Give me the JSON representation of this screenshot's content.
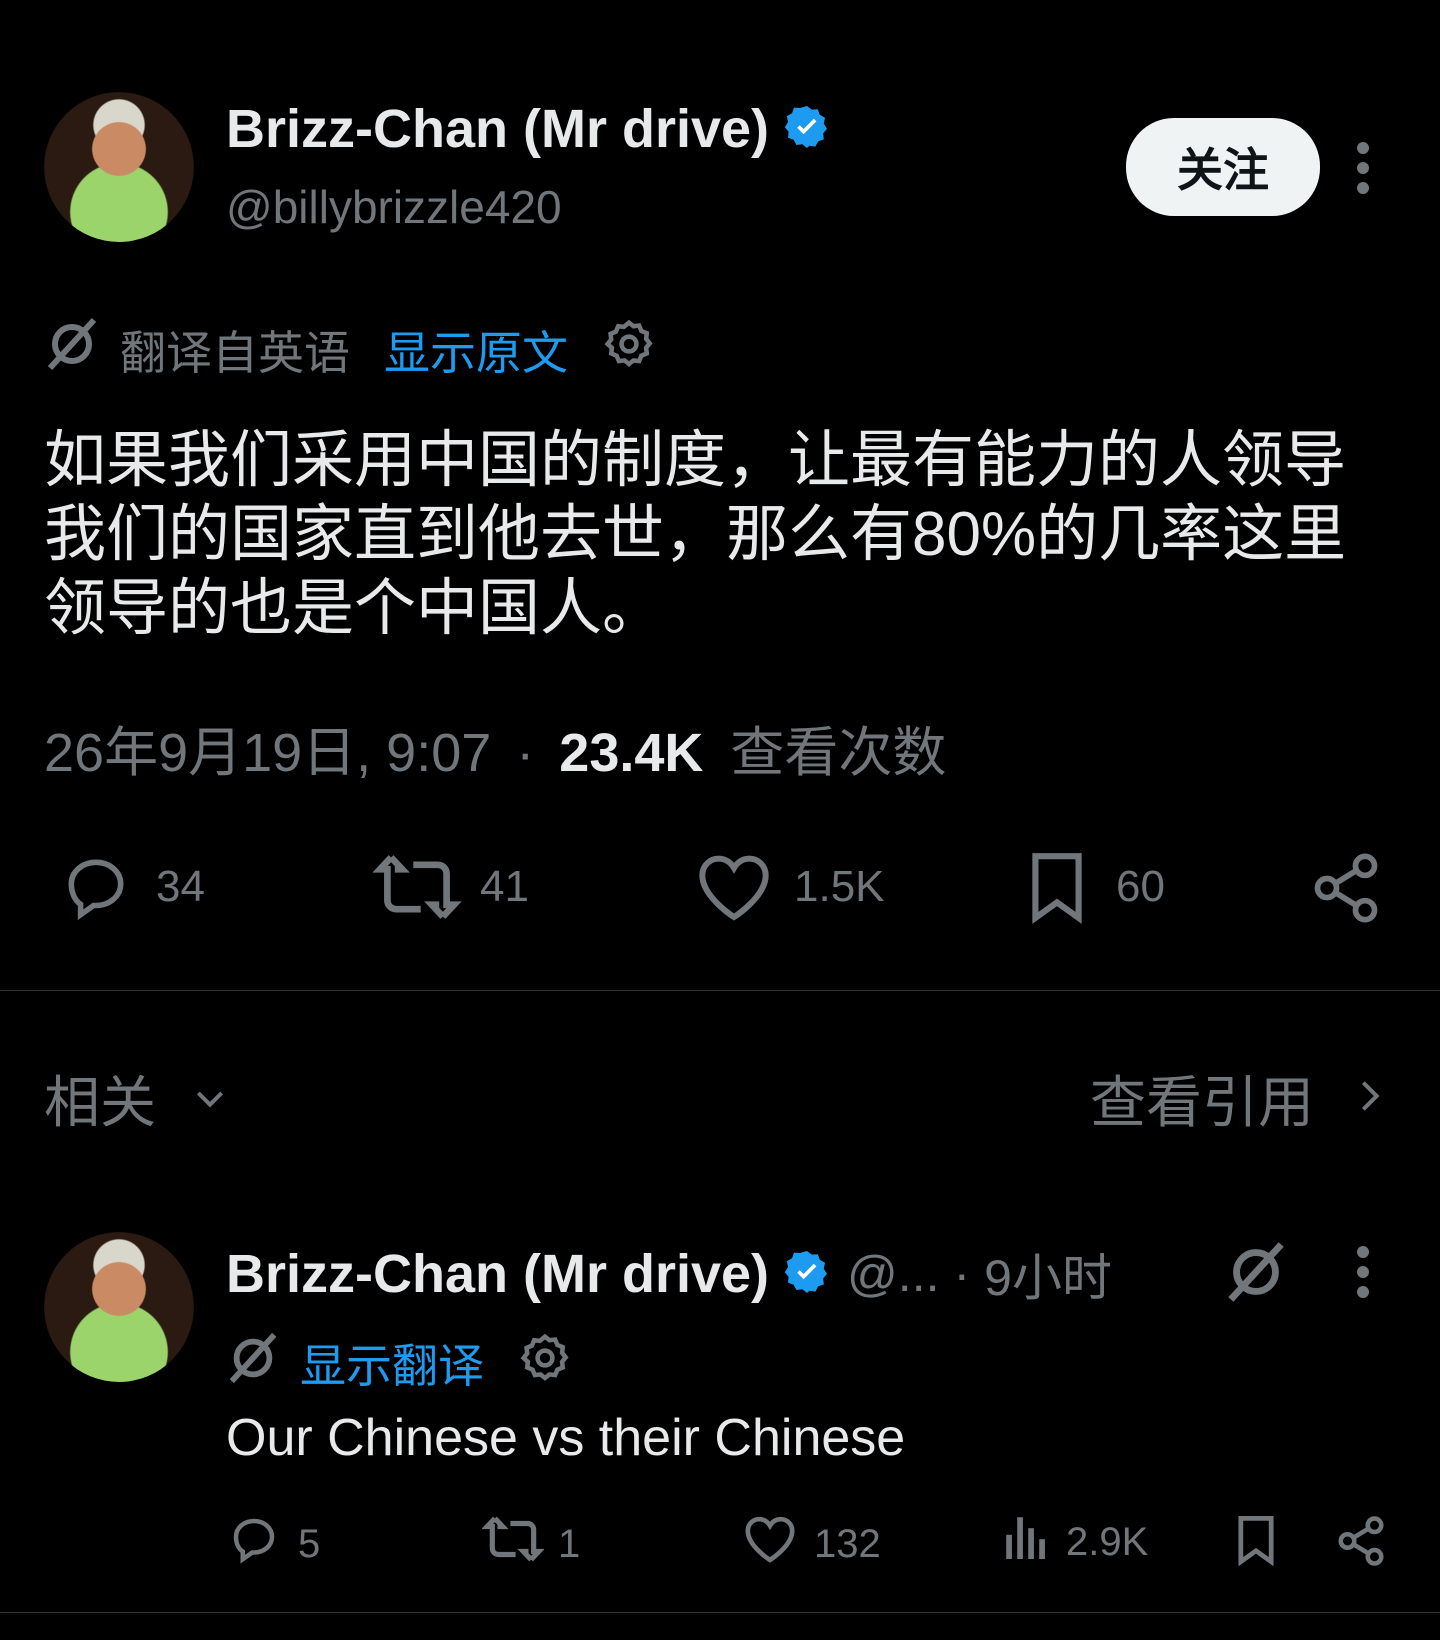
{
  "main_tweet": {
    "author_name": "Brizz-Chan (Mr drive)",
    "handle": "@billybrizzle420",
    "follow_label": "关注",
    "translated_from": "翻译自英语",
    "show_original": "显示原文",
    "text": "如果我们采用中国的制度，让最有能力的人领导我们的国家直到他去世，那么有80%的几率这里领导的也是个中国人。",
    "timestamp": "26年9月19日, 9:07",
    "separator": "·",
    "views_count": "23.4K",
    "views_label": "查看次数",
    "replies": "34",
    "reposts": "41",
    "likes": "1.5K",
    "bookmarks": "60"
  },
  "related": {
    "title": "相关",
    "view_quotes": "查看引用"
  },
  "reply_tweet": {
    "author_name": "Brizz-Chan (Mr drive)",
    "handle_truncated": "@...",
    "separator": "·",
    "time_ago": "9小时",
    "show_translation": "显示翻译",
    "text": "Our Chinese vs their Chinese",
    "replies": "5",
    "reposts": "1",
    "likes": "132",
    "views": "2.9K"
  },
  "colors": {
    "background": "#000000",
    "text_primary": "#e7e9ea",
    "text_muted": "#71767b",
    "accent_blue": "#1d9bf0",
    "divider": "#2f3336"
  },
  "icons": [
    "translate-icon",
    "gear-icon",
    "verified-badge-icon",
    "more-icon",
    "reply-icon",
    "repost-icon",
    "like-icon",
    "bookmark-icon",
    "share-icon",
    "chevron-down-icon",
    "chevron-right-icon",
    "views-icon"
  ]
}
